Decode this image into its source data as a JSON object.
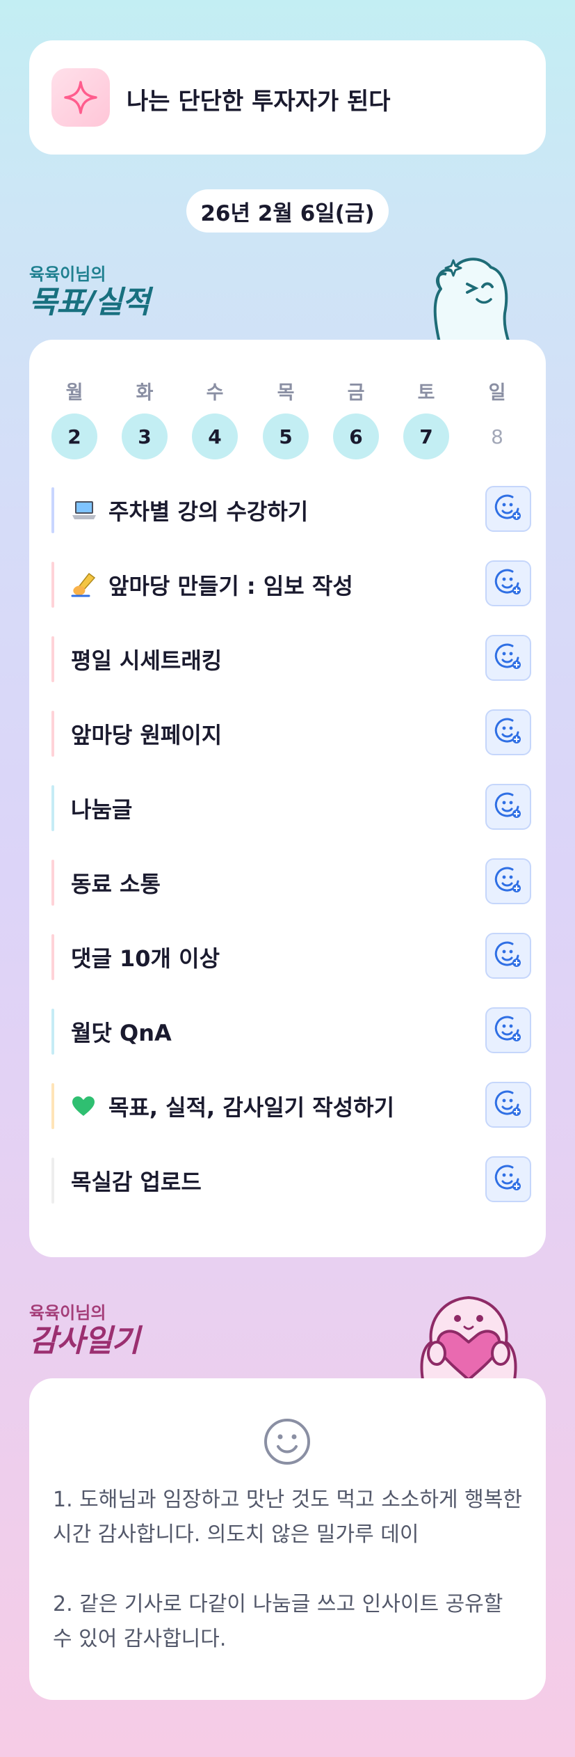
{
  "motto": {
    "text": "나는 단단한 투자자가 된다",
    "icon": "sparkle-icon"
  },
  "date": {
    "label": "26년 2월 6일(금)"
  },
  "goal_section": {
    "subtitle": "육육이님의",
    "title": "목표/실적"
  },
  "week": {
    "days": [
      {
        "label": "월",
        "num": "2",
        "active": true
      },
      {
        "label": "화",
        "num": "3",
        "active": true
      },
      {
        "label": "수",
        "num": "4",
        "active": true
      },
      {
        "label": "목",
        "num": "5",
        "active": true
      },
      {
        "label": "금",
        "num": "6",
        "active": true
      },
      {
        "label": "토",
        "num": "7",
        "active": true
      },
      {
        "label": "일",
        "num": "8",
        "active": false
      }
    ]
  },
  "goals": [
    {
      "emoji": "laptop-icon",
      "text": "주차별 강의 수강하기",
      "bar_color": "#c9d6ff"
    },
    {
      "emoji": "writing-hand-icon",
      "text": "앞마당 만들기 : 임보 작성",
      "bar_color": "#ffd3d8"
    },
    {
      "emoji": "",
      "text": "평일 시세트래킹",
      "bar_color": "#ffd3d8"
    },
    {
      "emoji": "",
      "text": "앞마당 원페이지",
      "bar_color": "#ffd3d8"
    },
    {
      "emoji": "",
      "text": "나눔글",
      "bar_color": "#c6ecf5"
    },
    {
      "emoji": "",
      "text": "동료 소통",
      "bar_color": "#ffd3d8"
    },
    {
      "emoji": "",
      "text": "댓글 10개 이상",
      "bar_color": "#ffd3d8"
    },
    {
      "emoji": "",
      "text": "월닷 QnA",
      "bar_color": "#c6ecf5"
    },
    {
      "emoji": "green-heart-icon",
      "text": "목표, 실적, 감사일기 작성하기",
      "bar_color": "#ffe4b8"
    },
    {
      "emoji": "",
      "text": "목실감 업로드",
      "bar_color": "#eeeeee"
    }
  ],
  "goal_button_icon": "smiley-add-icon",
  "gratitude_section": {
    "subtitle": "육육이님의",
    "title": "감사일기"
  },
  "gratitude": {
    "icon": "smile-icon",
    "entries": [
      "1. 도해님과 임장하고 맛난 것도 먹고 소소하게 행복한 시간 감사합니다. 의도치 않은 밀가루 데이",
      "2. 같은 기사로 다같이 나눔글 쓰고 인사이트 공유할 수 있어 감사합니다."
    ]
  },
  "colors": {
    "accent_teal": "#c3eef3",
    "goal_title": "#18707f",
    "gratitude_title": "#9b2f70",
    "button_blue": "#2f6fe4"
  }
}
